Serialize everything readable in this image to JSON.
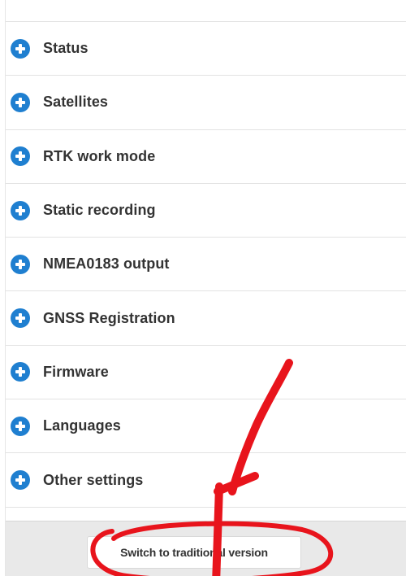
{
  "menu": {
    "items": [
      {
        "label": "Status",
        "icon": "plus-circle-icon"
      },
      {
        "label": "Satellites",
        "icon": "plus-circle-icon"
      },
      {
        "label": "RTK work mode",
        "icon": "plus-circle-icon"
      },
      {
        "label": "Static recording",
        "icon": "plus-circle-icon"
      },
      {
        "label": "NMEA0183 output",
        "icon": "plus-circle-icon"
      },
      {
        "label": "GNSS Registration",
        "icon": "plus-circle-icon"
      },
      {
        "label": "Firmware",
        "icon": "plus-circle-icon"
      },
      {
        "label": "Languages",
        "icon": "plus-circle-icon"
      },
      {
        "label": "Other settings",
        "icon": "plus-circle-icon"
      }
    ]
  },
  "footer": {
    "switch_label": "Switch to traditional version"
  },
  "colors": {
    "icon_blue": "#1f7fd0",
    "annotation_red": "#e8141c",
    "text": "#333333",
    "footer_bg": "#e9e9e9"
  }
}
